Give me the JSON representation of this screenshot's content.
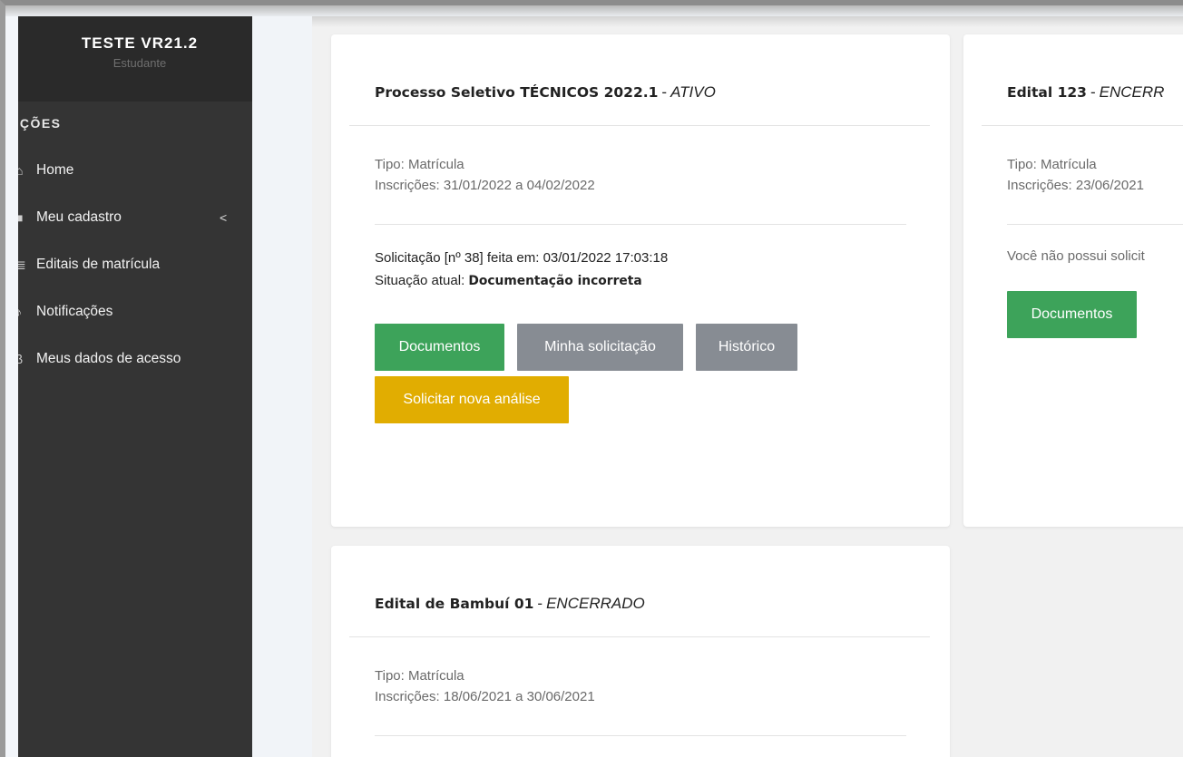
{
  "sidebar": {
    "brand_title": "TESTE VR21.2",
    "brand_subtitle": "Estudante",
    "section_label": "PÇÕES",
    "items": [
      {
        "label": "Home",
        "icon": "home-icon",
        "glyph": "⌂"
      },
      {
        "label": "Meu cadastro",
        "icon": "user-icon",
        "glyph": "■",
        "chevron": "<"
      },
      {
        "label": "Editais de matrícula",
        "icon": "document-icon",
        "glyph": "≣"
      },
      {
        "label": "Notificações",
        "icon": "bell-icon",
        "glyph": "♪"
      },
      {
        "label": "Meus dados de acesso",
        "icon": "key-icon",
        "glyph": "β"
      }
    ]
  },
  "cards": [
    {
      "title": "Processo Seletivo TÉCNICOS 2022.1",
      "separator": "-",
      "status": "ATIVO",
      "tipo": "Tipo: Matrícula",
      "inscricoes": "Inscrições: 31/01/2022 a 04/02/2022",
      "solicitacao": "Solicitação [nº 38] feita em: 03/01/2022 17:03:18",
      "situacao_label": "Situação atual: ",
      "situacao_value": "Documentação incorreta",
      "buttons": {
        "documentos": "Documentos",
        "minha_solicitacao": "Minha solicitação",
        "historico": "Histórico",
        "nova_analise": "Solicitar nova análise"
      }
    },
    {
      "title": "Edital 123",
      "separator": "-",
      "status": "ENCERR",
      "tipo": "Tipo: Matrícula",
      "inscricoes": "Inscrições: 23/06/2021",
      "note": "Você não possui solicit",
      "buttons": {
        "documentos": "Documentos"
      }
    },
    {
      "title": "Edital de Bambuí 01",
      "separator": "-",
      "status": "ENCERRADO",
      "tipo": "Tipo: Matrícula",
      "inscricoes": "Inscrições: 18/06/2021 a 30/06/2021"
    }
  ],
  "colors": {
    "sidebar_bg": "#343434",
    "sidebar_header_bg": "#2a2a2a",
    "green": "#3da35a",
    "gray": "#878c93",
    "yellow": "#e1ad01"
  }
}
